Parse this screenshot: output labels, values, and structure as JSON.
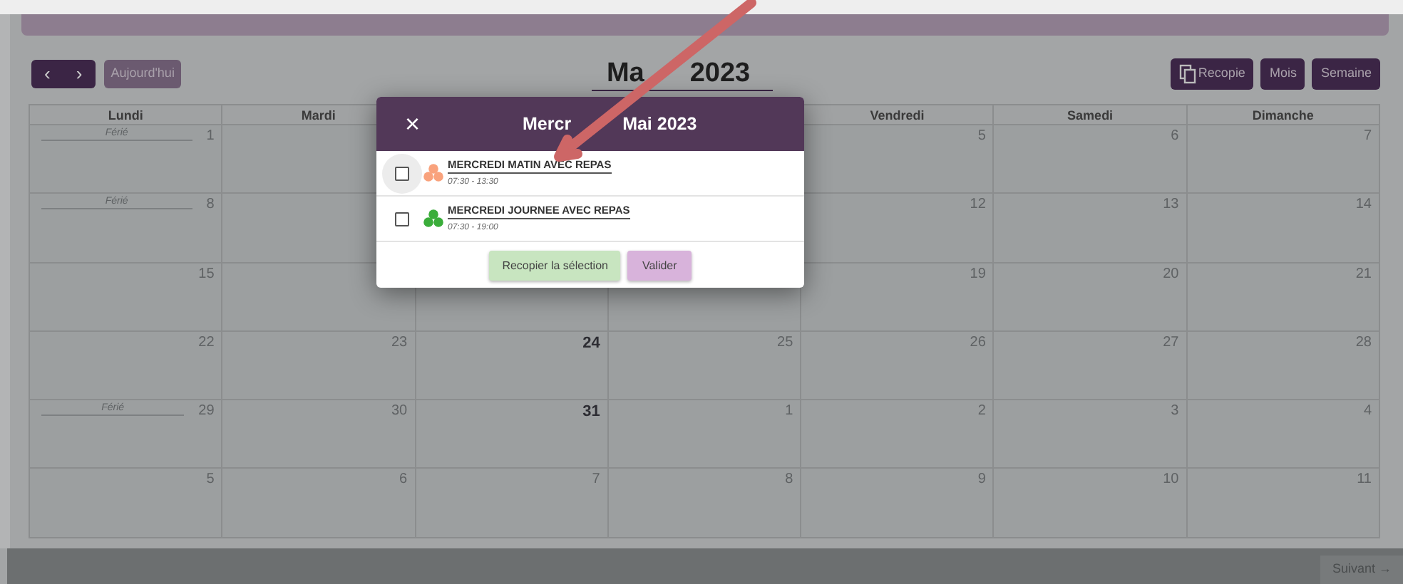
{
  "toolbar": {
    "prev": "‹",
    "next": "›",
    "today": "Aujourd'hui",
    "title_parts": [
      "Ma",
      "2023"
    ],
    "views": [
      {
        "label": "Recopie",
        "kind": "copy"
      },
      {
        "label": "Mois",
        "kind": "plain"
      },
      {
        "label": "Semaine",
        "kind": "plain"
      }
    ]
  },
  "calendar": {
    "columns_left": [
      "Lundi",
      "Mardi"
    ],
    "columns_right": [
      "Vendredi",
      "Samedi",
      "Dimanche"
    ],
    "weeks": [
      {
        "left": [
          {
            "day": "1",
            "note": "Férié",
            "highlighted": false
          }
        ],
        "right": [
          {
            "day": "5",
            "highlighted": false
          },
          {
            "day": "6",
            "highlighted": false
          },
          {
            "day": "7",
            "highlighted": false
          }
        ]
      },
      {
        "left": [
          {
            "day": "8",
            "note": "Férié",
            "highlighted": false
          }
        ],
        "right": [
          {
            "day": "12",
            "highlighted": false
          },
          {
            "day": "13",
            "highlighted": false
          },
          {
            "day": "14",
            "highlighted": false
          }
        ]
      },
      {
        "left": [
          {
            "day": "15",
            "highlighted": false
          }
        ],
        "right": [
          {
            "day": "19",
            "highlighted": false
          },
          {
            "day": "20",
            "highlighted": false
          },
          {
            "day": "21",
            "highlighted": false
          }
        ]
      },
      {
        "left": [
          {
            "day": "22",
            "highlighted": false
          },
          {
            "day": "23",
            "highlighted": false
          },
          {
            "day": "24",
            "highlighted": true
          },
          {
            "day": "25",
            "highlighted": false
          }
        ],
        "right": [
          {
            "day": "26",
            "highlighted": false
          },
          {
            "day": "27",
            "highlighted": false
          },
          {
            "day": "28",
            "highlighted": false
          }
        ]
      },
      {
        "left": [
          {
            "day": "29",
            "note": "Férié",
            "highlighted": false
          },
          {
            "day": "30",
            "highlighted": false
          },
          {
            "day": "31",
            "highlighted": true
          },
          {
            "day": "1",
            "highlighted": false
          }
        ],
        "right": [
          {
            "day": "2",
            "highlighted": false
          },
          {
            "day": "3",
            "highlighted": false
          },
          {
            "day": "4",
            "highlighted": false
          }
        ]
      },
      {
        "left": [
          {
            "day": "5",
            "highlighted": false
          },
          {
            "day": "6",
            "highlighted": false
          },
          {
            "day": "7",
            "highlighted": false
          },
          {
            "day": "8",
            "highlighted": false
          }
        ],
        "right": [
          {
            "day": "9",
            "highlighted": false
          },
          {
            "day": "10",
            "highlighted": false
          },
          {
            "day": "11",
            "highlighted": false
          }
        ]
      }
    ]
  },
  "modal": {
    "close": "×",
    "title_parts": [
      "Mercr",
      "Mai 2023"
    ],
    "events": [
      {
        "title": "MERCREDI MATIN AVEC REPAS",
        "time": "07:30 - 13:30",
        "checked": false,
        "hovered": true,
        "color": "#f9a27c"
      },
      {
        "title": "MERCREDI JOURNEE AVEC REPAS",
        "time": "07:30 - 19:00",
        "checked": false,
        "hovered": false,
        "color": "#3aad3a"
      }
    ],
    "buttons": [
      {
        "label": "Recopier la sélection",
        "kind": "copy"
      },
      {
        "label": "Valider",
        "kind": "confirm"
      }
    ]
  },
  "footer": {
    "next": "Suivant →"
  }
}
